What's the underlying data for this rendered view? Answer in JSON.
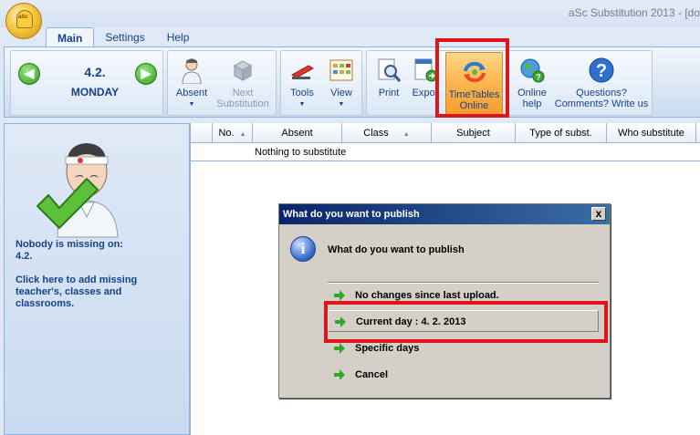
{
  "app": {
    "title": "aSc Substitution 2013 - [do"
  },
  "tabs": [
    {
      "label": "Main"
    },
    {
      "label": "Settings"
    },
    {
      "label": "Help"
    }
  ],
  "ribbon": {
    "date": "4.2.",
    "day": "MONDAY",
    "absent": "Absent",
    "next_substitution_line1": "Next",
    "next_substitution_line2": "Substitution",
    "tools": "Tools",
    "view": "View",
    "print": "Print",
    "export": "Expor",
    "timetables_online_line1": "TimeTables",
    "timetables_online_line2": "Online",
    "online_help_line1": "Online",
    "online_help_line2": "help",
    "questions_line1": "Questions?",
    "questions_line2": "Comments? Write us"
  },
  "left_panel": {
    "line1": "Nobody is missing on:",
    "line2": "4.2.",
    "line3": "Click here to add missing",
    "line4": "teacher's, classes and",
    "line5": "classrooms."
  },
  "table": {
    "columns": [
      "No.",
      "Absent",
      "Class",
      "Subject",
      "Type of subst.",
      "Who substitute"
    ],
    "empty_message": "Nothing to substitute"
  },
  "dialog": {
    "title": "What do you want to publish",
    "heading": "What do you want to publish",
    "options": [
      {
        "label": "No changes since last upload."
      },
      {
        "label": "Current day : 4. 2. 2013"
      },
      {
        "label": "Specific days"
      },
      {
        "label": "Cancel"
      }
    ],
    "close_symbol": "x"
  },
  "colors": {
    "highlight": "#e0151b",
    "ribbon_text": "#15428b",
    "dialog_title_bg": "#0a246a"
  }
}
